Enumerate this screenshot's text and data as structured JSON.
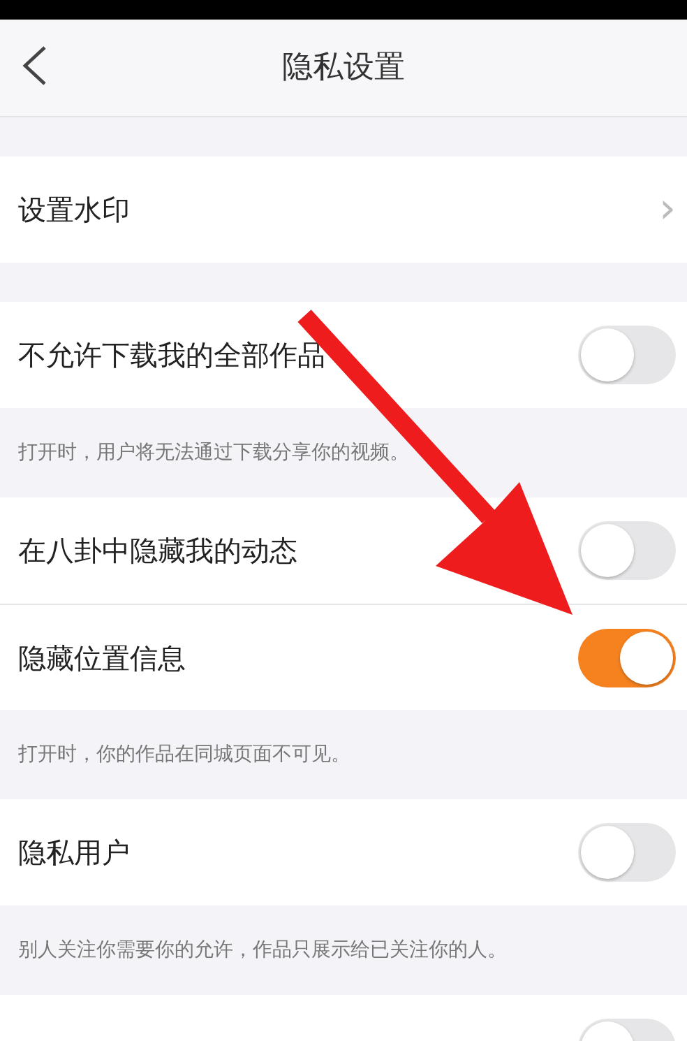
{
  "header": {
    "title": "隐私设置"
  },
  "sections": [
    {
      "rows": [
        {
          "kind": "link",
          "label": "设置水印",
          "chevron": "›"
        }
      ]
    },
    {
      "rows": [
        {
          "kind": "toggle",
          "label": "不允许下载我的全部作品",
          "on": false
        }
      ],
      "note": "打开时，用户将无法通过下载分享你的视频。"
    },
    {
      "rows": [
        {
          "kind": "toggle",
          "label": "在八卦中隐藏我的动态",
          "on": false
        },
        {
          "kind": "toggle",
          "label": "隐藏位置信息",
          "on": true
        }
      ],
      "note": "打开时，你的作品在同城页面不可见。"
    },
    {
      "rows": [
        {
          "kind": "toggle",
          "label": "隐私用户",
          "on": false
        }
      ],
      "note": "别人关注你需要你的允许，作品只展示给已关注你的人。"
    },
    {
      "rows": [
        {
          "kind": "toggle",
          "on": false
        }
      ]
    }
  ]
}
